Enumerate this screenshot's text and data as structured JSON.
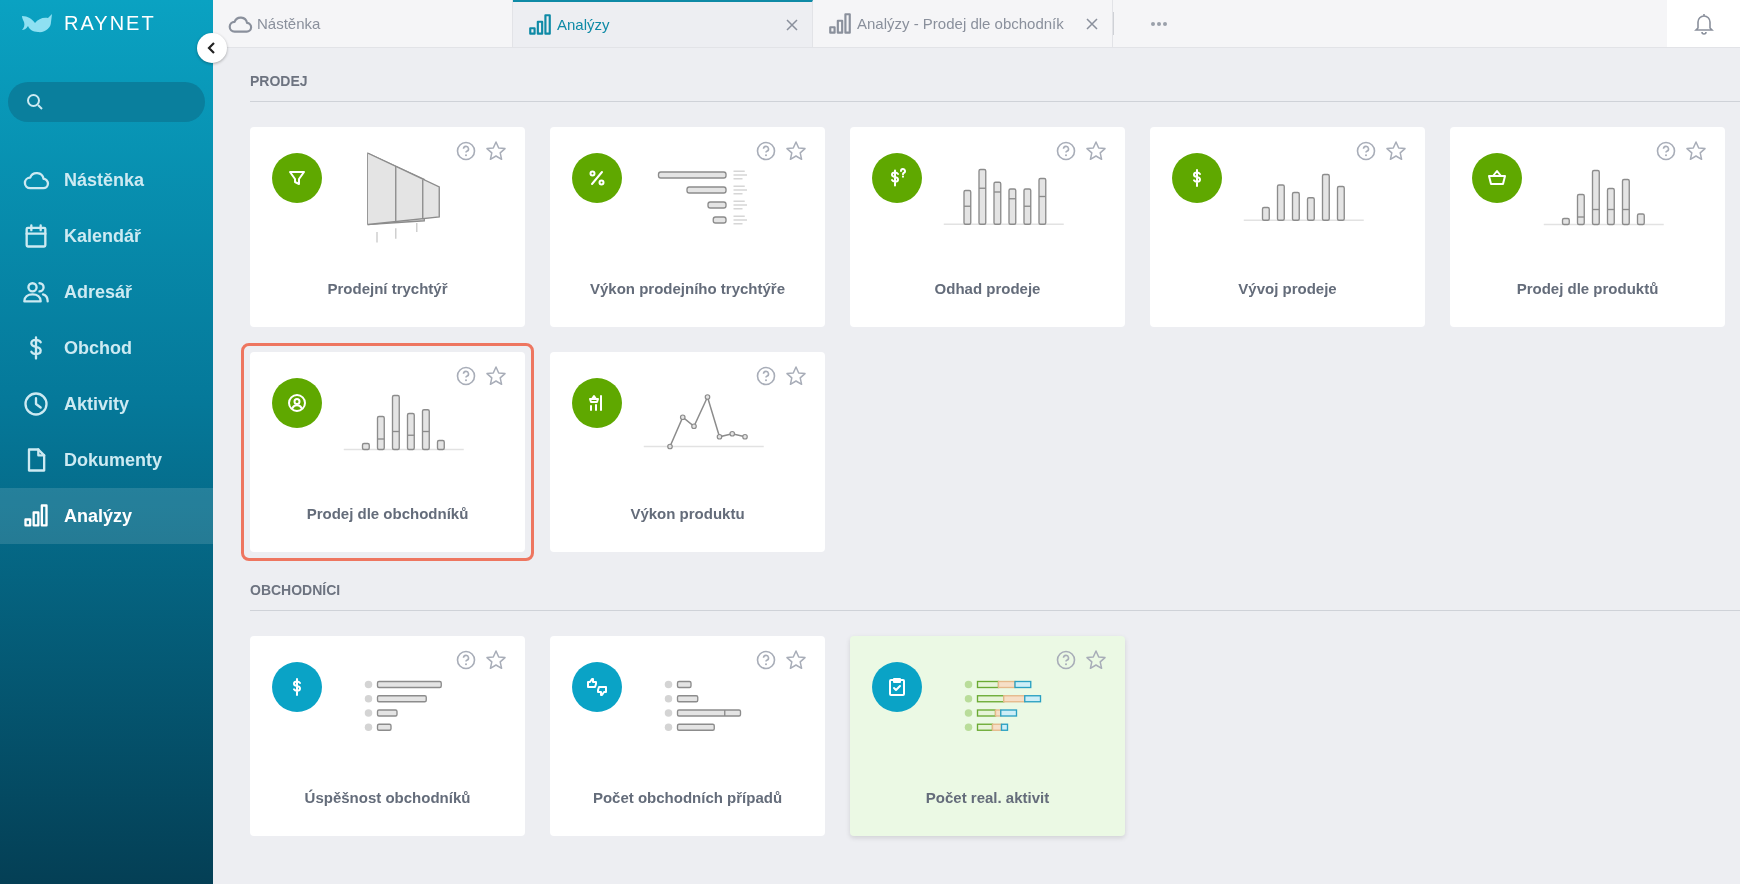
{
  "sidebar": {
    "logo": "RAYNET",
    "items": [
      {
        "label": "Nástěnka",
        "kind": "cloud",
        "selected": false
      },
      {
        "label": "Kalendář",
        "kind": "calendar",
        "selected": false
      },
      {
        "label": "Adresář",
        "kind": "people",
        "selected": false
      },
      {
        "label": "Obchod",
        "kind": "dollar",
        "selected": false
      },
      {
        "label": "Aktivity",
        "kind": "clock",
        "selected": false
      },
      {
        "label": "Dokumenty",
        "kind": "document",
        "selected": false
      },
      {
        "label": "Analýzy",
        "kind": "chart",
        "selected": true
      }
    ]
  },
  "tabs": [
    {
      "label": "Nástěnka",
      "kind": "cloud",
      "selected": false,
      "closable": false
    },
    {
      "label": "Analýzy",
      "kind": "chart",
      "selected": true,
      "closable": true
    },
    {
      "label": "Analýzy - Prodej dle obchodník",
      "kind": "chart",
      "selected": false,
      "closable": true
    }
  ],
  "sections": [
    {
      "title": "PRODEJ",
      "cards": [
        {
          "title": "Prodejní trychtýř",
          "kind": "funnel",
          "color": "#5fa800",
          "outlined": false,
          "tinted": false
        },
        {
          "title": "Výkon prodejního trychtýře",
          "kind": "conversion",
          "color": "#5fa800",
          "outlined": false,
          "tinted": false
        },
        {
          "title": "Odhad prodeje",
          "kind": "forecast",
          "color": "#5fa800",
          "outlined": false,
          "tinted": false
        },
        {
          "title": "Vývoj prodeje",
          "kind": "trend",
          "color": "#5fa800",
          "outlined": false,
          "tinted": false
        },
        {
          "title": "Prodej dle produktů",
          "kind": "products",
          "color": "#5fa800",
          "outlined": false,
          "tinted": false
        },
        {
          "title": "Prodej dle obchodníků",
          "kind": "salespeople",
          "color": "#5fa800",
          "outlined": true,
          "tinted": false
        },
        {
          "title": "Výkon produktu",
          "kind": "product-line",
          "color": "#5fa800",
          "outlined": false,
          "tinted": false
        }
      ]
    },
    {
      "title": "OBCHODNÍCI",
      "cards": [
        {
          "title": "Úspěšnost obchodníků",
          "kind": "success",
          "color": "#0aa3c6",
          "outlined": false,
          "tinted": false
        },
        {
          "title": "Počet obchodních případů",
          "kind": "deals",
          "color": "#0aa3c6",
          "outlined": false,
          "tinted": false
        },
        {
          "title": "Počet real. aktivit",
          "kind": "activities",
          "color": "#0aa3c6",
          "outlined": false,
          "tinted": true
        }
      ]
    }
  ]
}
